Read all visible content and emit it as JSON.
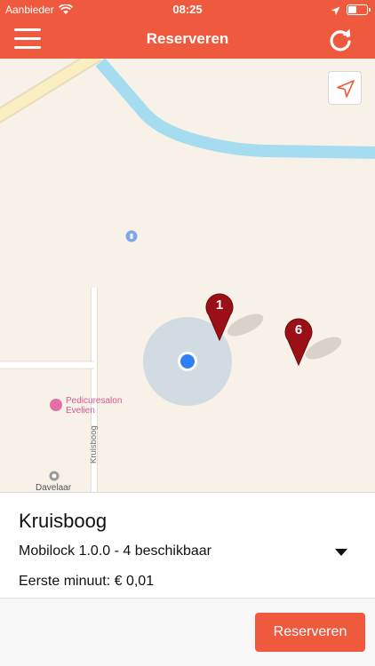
{
  "status_bar": {
    "carrier": "Aanbieder",
    "time": "08:25",
    "battery_level": 0.45,
    "icons": [
      "wifi-icon",
      "location-arrow-icon",
      "battery-icon"
    ]
  },
  "navbar": {
    "title": "Reserveren",
    "icons": [
      "menu-icon",
      "refresh-icon"
    ]
  },
  "map": {
    "poi": {
      "name_line1": "Pedicuresalon",
      "name_line2": "Evelien"
    },
    "street": "Kruisboog",
    "place": "Davelaar",
    "pins": [
      {
        "label": "1"
      },
      {
        "label": "6"
      }
    ],
    "colors": {
      "water": "#a6dcf0",
      "road": "#ffffff",
      "major_road": "#fbeec0",
      "land": "#f7f1e8",
      "pin": "#9b1016",
      "user_dot": "#2f80f6"
    }
  },
  "panel": {
    "location_name": "Kruisboog",
    "lock_selection": "Mobilock 1.0.0 - 4 beschikbaar",
    "price_text": "Eerste minuut: € 0,01",
    "reserve_button": "Reserveren"
  },
  "colors": {
    "accent": "#ef5a3f"
  }
}
